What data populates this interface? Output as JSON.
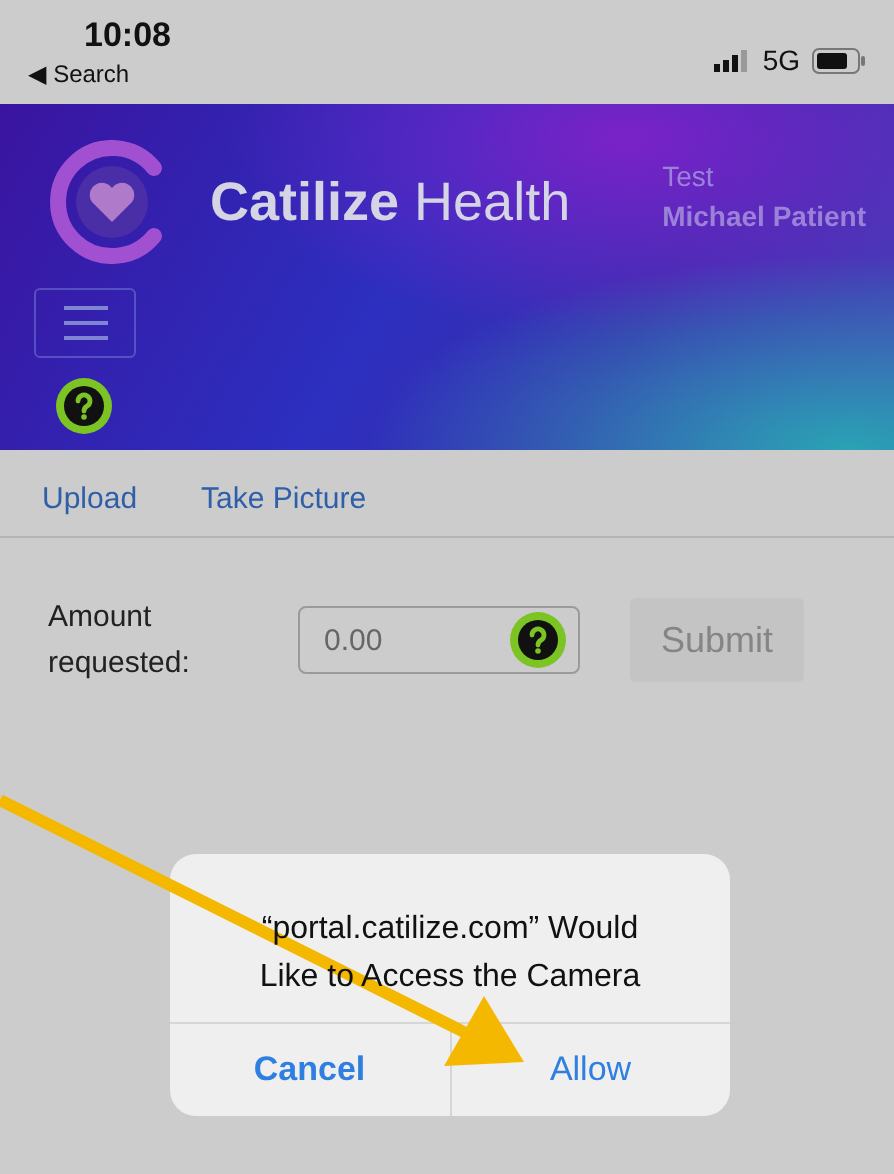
{
  "status_bar": {
    "time": "10:08",
    "back_label": "◀ Search",
    "network": "5G"
  },
  "header": {
    "brand_bold": "Catilize",
    "brand_light": "Health",
    "user_line_1": "Test",
    "user_name": "Michael Patient"
  },
  "links": [
    "Upload",
    "Take Picture"
  ],
  "form": {
    "label": "Amount requested:",
    "placeholder": "0.00",
    "submit": {
      "label": "Submit",
      "disabled": true
    }
  },
  "dialog": {
    "message": "“portal.catilize.com” Would Like to Access the Camera",
    "buttons": [
      {
        "label": "Cancel",
        "kind": "cancel"
      },
      {
        "label": "Allow",
        "kind": "default"
      }
    ]
  }
}
